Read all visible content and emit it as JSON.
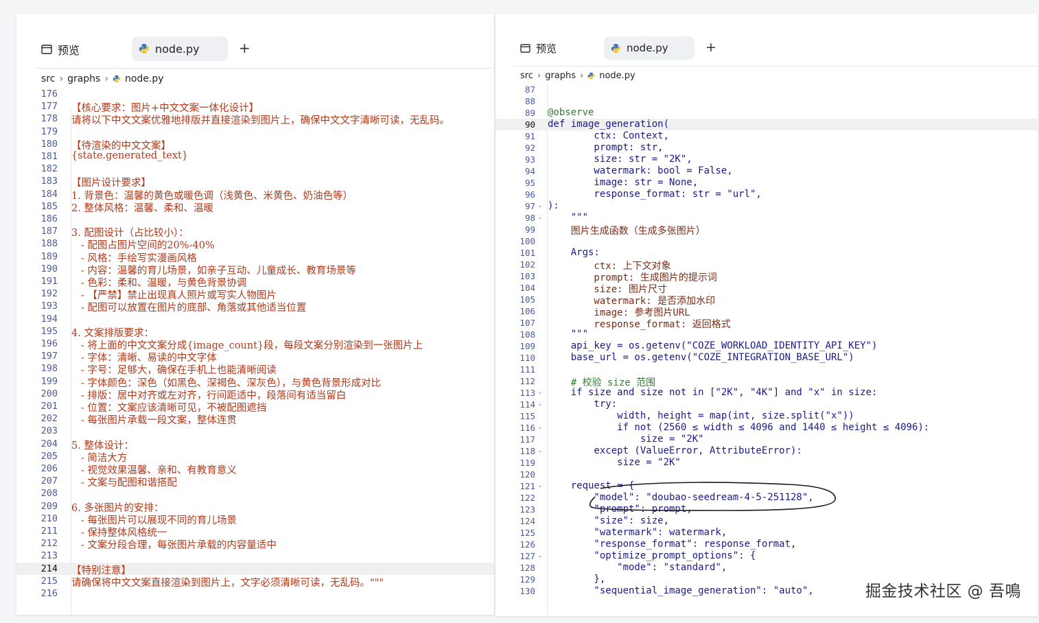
{
  "left_editor": {
    "tabs": {
      "preview_label": "预览",
      "file_label": "node.py",
      "add_label": "+"
    },
    "breadcrumb": [
      "src",
      "graphs",
      "node.py"
    ],
    "active_line": "214",
    "lines": [
      {
        "num": "176",
        "text": ""
      },
      {
        "num": "177",
        "text": "【核心要求：图片+中文文案一体化设计】"
      },
      {
        "num": "178",
        "text": "请将以下中文文案优雅地排版并直接渲染到图片上，确保中文文字清晰可读，无乱码。"
      },
      {
        "num": "179",
        "text": ""
      },
      {
        "num": "180",
        "text": "【待渲染的中文文案】"
      },
      {
        "num": "181",
        "text": "{state.generated_text}"
      },
      {
        "num": "182",
        "text": ""
      },
      {
        "num": "183",
        "text": "【图片设计要求】"
      },
      {
        "num": "184",
        "text": "1. 背景色：温馨的黄色或暖色调（浅黄色、米黄色、奶油色等）"
      },
      {
        "num": "185",
        "text": "2. 整体风格：温馨、柔和、温暖"
      },
      {
        "num": "186",
        "text": ""
      },
      {
        "num": "187",
        "text": "3. 配图设计（占比较小）："
      },
      {
        "num": "188",
        "text": "   - 配图占图片空间的20%-40%"
      },
      {
        "num": "189",
        "text": "   - 风格：手绘写实漫画风格"
      },
      {
        "num": "190",
        "text": "   - 内容：温馨的育儿场景，如亲子互动、儿童成长、教育场景等"
      },
      {
        "num": "191",
        "text": "   - 色彩：柔和、温暖，与黄色背景协调"
      },
      {
        "num": "192",
        "text": "   - 【严禁】禁止出现真人照片或写实人物图片"
      },
      {
        "num": "193",
        "text": "   - 配图可以放置在图片的底部、角落或其他适当位置"
      },
      {
        "num": "194",
        "text": ""
      },
      {
        "num": "195",
        "text": "4. 文案排版要求："
      },
      {
        "num": "196",
        "text": "   - 将上面的中文文案分成{image_count}段，每段文案分别渲染到一张图片上"
      },
      {
        "num": "197",
        "text": "   - 字体：清晰、易读的中文字体"
      },
      {
        "num": "198",
        "text": "   - 字号：足够大，确保在手机上也能清晰阅读"
      },
      {
        "num": "199",
        "text": "   - 字体颜色：深色（如黑色、深褐色、深灰色），与黄色背景形成对比"
      },
      {
        "num": "200",
        "text": "   - 排版：居中对齐或左对齐，行间距适中，段落间有适当留白"
      },
      {
        "num": "201",
        "text": "   - 位置：文案应该清晰可见，不被配图遮挡"
      },
      {
        "num": "202",
        "text": "   - 每张图片承载一段文案，整体连贯"
      },
      {
        "num": "203",
        "text": ""
      },
      {
        "num": "204",
        "text": "5. 整体设计："
      },
      {
        "num": "205",
        "text": "   - 简洁大方"
      },
      {
        "num": "206",
        "text": "   - 视觉效果温馨、亲和、有教育意义"
      },
      {
        "num": "207",
        "text": "   - 文案与配图和谐搭配"
      },
      {
        "num": "208",
        "text": ""
      },
      {
        "num": "209",
        "text": "6. 多张图片的安排："
      },
      {
        "num": "210",
        "text": "   - 每张图片可以展现不同的育儿场景"
      },
      {
        "num": "211",
        "text": "   - 保持整体风格统一"
      },
      {
        "num": "212",
        "text": "   - 文案分段合理，每张图片承载的内容量适中"
      },
      {
        "num": "213",
        "text": ""
      },
      {
        "num": "214",
        "text": "【特别注意】"
      },
      {
        "num": "215",
        "text": "请确保将中文文案直接渲染到图片上，文字必须清晰可读，无乱码。\"\"\""
      },
      {
        "num": "216",
        "text": ""
      }
    ]
  },
  "right_editor": {
    "tabs": {
      "preview_label": "预览",
      "file_label": "node.py",
      "add_label": "+"
    },
    "breadcrumb": [
      "src",
      "graphs",
      "node.py"
    ],
    "active_line": "90",
    "lines": [
      {
        "num": "87",
        "text": "",
        "fold": ""
      },
      {
        "num": "88",
        "text": "",
        "fold": ""
      },
      {
        "num": "89",
        "text": "@observe",
        "fold": ""
      },
      {
        "num": "90",
        "text": "def image_generation(",
        "fold": ""
      },
      {
        "num": "91",
        "text": "        ctx: Context,",
        "fold": ""
      },
      {
        "num": "92",
        "text": "        prompt: str,",
        "fold": ""
      },
      {
        "num": "93",
        "text": "        size: str = \"2K\",",
        "fold": ""
      },
      {
        "num": "94",
        "text": "        watermark: bool = False,",
        "fold": ""
      },
      {
        "num": "95",
        "text": "        image: str = None,",
        "fold": ""
      },
      {
        "num": "96",
        "text": "        response_format: str = \"url\",",
        "fold": ""
      },
      {
        "num": "97",
        "text": "):",
        "fold": "⌄"
      },
      {
        "num": "98",
        "text": "    \"\"\"",
        "fold": "⌄"
      },
      {
        "num": "99",
        "text": "    图片生成函数（生成多张图片）",
        "fold": ""
      },
      {
        "num": "100",
        "text": "",
        "fold": ""
      },
      {
        "num": "101",
        "text": "    Args:",
        "fold": ""
      },
      {
        "num": "102",
        "text": "        ctx: 上下文对象",
        "fold": ""
      },
      {
        "num": "103",
        "text": "        prompt: 生成图片的提示词",
        "fold": ""
      },
      {
        "num": "104",
        "text": "        size: 图片尺寸",
        "fold": ""
      },
      {
        "num": "105",
        "text": "        watermark: 是否添加水印",
        "fold": ""
      },
      {
        "num": "106",
        "text": "        image: 参考图片URL",
        "fold": ""
      },
      {
        "num": "107",
        "text": "        response_format: 返回格式",
        "fold": ""
      },
      {
        "num": "108",
        "text": "    \"\"\"",
        "fold": ""
      },
      {
        "num": "109",
        "text": "    api_key = os.getenv(\"COZE_WORKLOAD_IDENTITY_API_KEY\")",
        "fold": ""
      },
      {
        "num": "110",
        "text": "    base_url = os.getenv(\"COZE_INTEGRATION_BASE_URL\")",
        "fold": ""
      },
      {
        "num": "111",
        "text": "",
        "fold": ""
      },
      {
        "num": "112",
        "text": "    # 校验 size 范围",
        "fold": ""
      },
      {
        "num": "113",
        "text": "    if size and size not in [\"2K\", \"4K\"] and \"x\" in size:",
        "fold": "⌄"
      },
      {
        "num": "114",
        "text": "        try:",
        "fold": "⌄"
      },
      {
        "num": "115",
        "text": "            width, height = map(int, size.split(\"x\"))",
        "fold": ""
      },
      {
        "num": "116",
        "text": "            if not (2560 ≤ width ≤ 4096 and 1440 ≤ height ≤ 4096):",
        "fold": "⌄"
      },
      {
        "num": "117",
        "text": "                size = \"2K\"",
        "fold": ""
      },
      {
        "num": "118",
        "text": "        except (ValueError, AttributeError):",
        "fold": "⌄"
      },
      {
        "num": "119",
        "text": "            size = \"2K\"",
        "fold": ""
      },
      {
        "num": "120",
        "text": "",
        "fold": ""
      },
      {
        "num": "121",
        "text": "    request = {",
        "fold": "⌄"
      },
      {
        "num": "122",
        "text": "        \"model\": \"doubao-seedream-4-5-251128\",",
        "fold": ""
      },
      {
        "num": "123",
        "text": "        \"prompt\": prompt,",
        "fold": ""
      },
      {
        "num": "124",
        "text": "        \"size\": size,",
        "fold": ""
      },
      {
        "num": "125",
        "text": "        \"watermark\": watermark,",
        "fold": ""
      },
      {
        "num": "126",
        "text": "        \"response_format\": response_format,",
        "fold": ""
      },
      {
        "num": "127",
        "text": "        \"optimize_prompt_options\": {",
        "fold": "⌄"
      },
      {
        "num": "128",
        "text": "            \"mode\": \"standard\",",
        "fold": ""
      },
      {
        "num": "129",
        "text": "        },",
        "fold": ""
      },
      {
        "num": "130",
        "text": "        \"sequential_image_generation\": \"auto\",",
        "fold": ""
      }
    ]
  },
  "watermark_text": "掘金技术社区 @ 吾鳴",
  "colors": {
    "line_number": "#4a5a9a",
    "prompt_text": "#b23a1a",
    "code_text": "#1a1a8a",
    "active_line_bg": "#f0f0f0",
    "tab_bg": "#eef0f3"
  },
  "icons": {
    "preview": "preview-window-icon",
    "file": "python-file-icon",
    "chevron": "chevron-right-icon",
    "fold": "fold-chevron-icon"
  }
}
